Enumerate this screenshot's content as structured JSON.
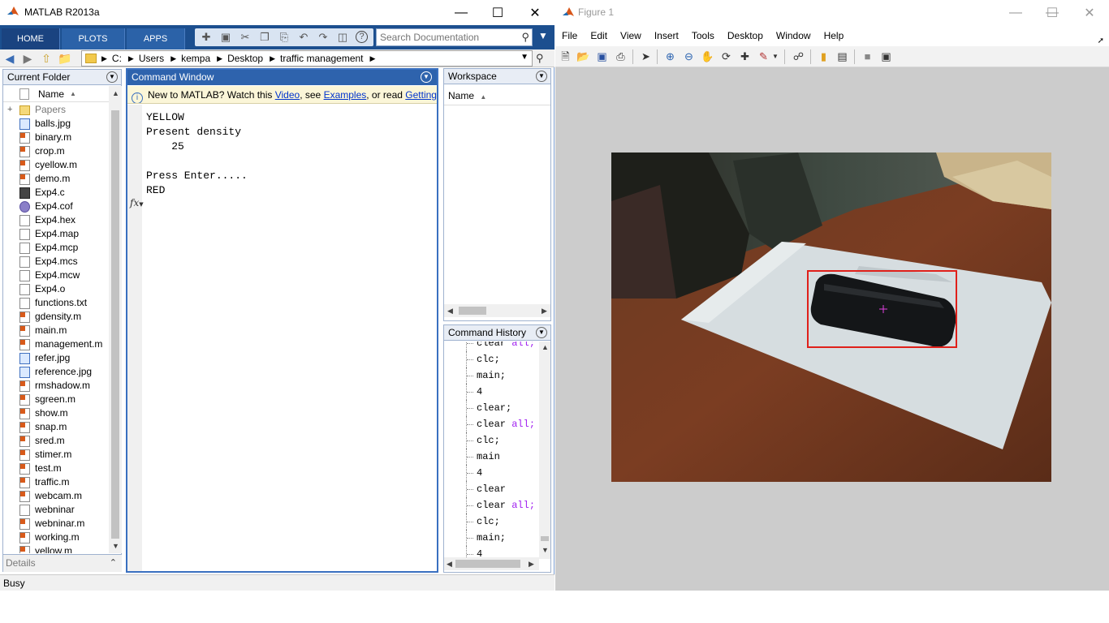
{
  "matlab": {
    "title": "MATLAB R2013a",
    "ribbon_tabs": [
      "HOME",
      "PLOTS",
      "APPS"
    ],
    "search_placeholder": "Search Documentation",
    "path": [
      "C:",
      "Users",
      "kempa",
      "Desktop",
      "traffic management"
    ],
    "current_folder": {
      "title": "Current Folder",
      "column": "Name",
      "files": [
        {
          "name": "Papers",
          "icon": "folder-icon"
        },
        {
          "name": "balls.jpg",
          "icon": "image-file-icon"
        },
        {
          "name": "binary.m",
          "icon": "m-file-icon"
        },
        {
          "name": "crop.m",
          "icon": "m-file-icon"
        },
        {
          "name": "cyellow.m",
          "icon": "function-file-icon"
        },
        {
          "name": "demo.m",
          "icon": "m-file-icon"
        },
        {
          "name": "Exp4.c",
          "icon": "c-file-icon"
        },
        {
          "name": "Exp4.cof",
          "icon": "cof-file-icon"
        },
        {
          "name": "Exp4.hex",
          "icon": "file-icon"
        },
        {
          "name": "Exp4.map",
          "icon": "file-icon"
        },
        {
          "name": "Exp4.mcp",
          "icon": "file-icon"
        },
        {
          "name": "Exp4.mcs",
          "icon": "file-icon"
        },
        {
          "name": "Exp4.mcw",
          "icon": "file-icon"
        },
        {
          "name": "Exp4.o",
          "icon": "file-icon"
        },
        {
          "name": "functions.txt",
          "icon": "text-file-icon"
        },
        {
          "name": "gdensity.m",
          "icon": "function-file-icon"
        },
        {
          "name": "main.m",
          "icon": "m-file-icon"
        },
        {
          "name": "management.m",
          "icon": "m-file-icon"
        },
        {
          "name": "refer.jpg",
          "icon": "image-file-icon"
        },
        {
          "name": "reference.jpg",
          "icon": "image-file-icon"
        },
        {
          "name": "rmshadow.m",
          "icon": "function-file-icon"
        },
        {
          "name": "sgreen.m",
          "icon": "function-file-icon"
        },
        {
          "name": "show.m",
          "icon": "function-file-icon"
        },
        {
          "name": "snap.m",
          "icon": "m-file-icon"
        },
        {
          "name": "sred.m",
          "icon": "function-file-icon"
        },
        {
          "name": "stimer.m",
          "icon": "function-file-icon"
        },
        {
          "name": "test.m",
          "icon": "m-file-icon"
        },
        {
          "name": "traffic.m",
          "icon": "m-file-icon"
        },
        {
          "name": "webcam.m",
          "icon": "m-file-icon"
        },
        {
          "name": "webninar",
          "icon": "file-icon"
        },
        {
          "name": "webninar.m",
          "icon": "m-file-icon"
        },
        {
          "name": "working.m",
          "icon": "m-file-icon"
        },
        {
          "name": "yellow.m",
          "icon": "function-file-icon"
        }
      ],
      "details": "Details"
    },
    "command_window": {
      "title": "Command Window",
      "notice_prefix": "New to MATLAB? Watch this ",
      "notice_link1": "Video",
      "notice_mid1": ", see ",
      "notice_link2": "Examples",
      "notice_mid2": ", or read ",
      "notice_link3": "Getting St",
      "output": "YELLOW\nPresent density\n    25\n\nPress Enter.....\nRED",
      "prompt": "fx"
    },
    "workspace": {
      "title": "Workspace",
      "column": "Name"
    },
    "command_history": {
      "title": "Command History",
      "lines": [
        [
          {
            "t": "clear "
          },
          {
            "t": "all;",
            "kw": true
          }
        ],
        [
          {
            "t": "clc;"
          }
        ],
        [
          {
            "t": "main;"
          }
        ],
        [
          {
            "t": "4"
          }
        ],
        [
          {
            "t": "clear;"
          }
        ],
        [
          {
            "t": "clear "
          },
          {
            "t": "all;",
            "kw": true
          }
        ],
        [
          {
            "t": "clc;"
          }
        ],
        [
          {
            "t": "main"
          }
        ],
        [
          {
            "t": "4"
          }
        ],
        [
          {
            "t": "clear"
          }
        ],
        [
          {
            "t": "clear "
          },
          {
            "t": "all;",
            "kw": true
          }
        ],
        [
          {
            "t": "clc;"
          }
        ],
        [
          {
            "t": "main;"
          }
        ],
        [
          {
            "t": "4"
          }
        ]
      ]
    },
    "status": "Busy"
  },
  "figure": {
    "title": "Figure 1",
    "menu": [
      "File",
      "Edit",
      "View",
      "Insert",
      "Tools",
      "Desktop",
      "Window",
      "Help"
    ],
    "toolbar_icons": [
      "new-figure-icon",
      "open-file-icon",
      "save-icon",
      "print-icon",
      "edit-plot-icon",
      "zoom-in-icon",
      "zoom-out-icon",
      "pan-icon",
      "rotate-3d-icon",
      "data-cursor-icon",
      "brush-icon",
      "link-icon",
      "colorbar-icon",
      "legend-icon",
      "hide-plot-tools-icon",
      "show-plot-tools-icon"
    ],
    "colors": {
      "bbox": "#e0201a",
      "centroid": "#e040e0"
    }
  }
}
